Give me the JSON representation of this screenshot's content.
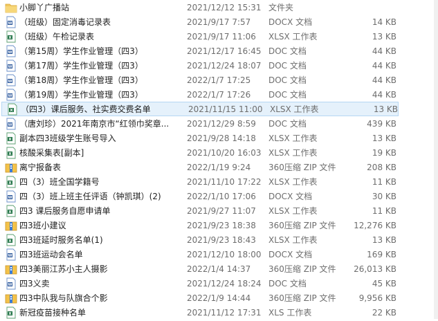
{
  "files": [
    {
      "name": "小脚丫广播站",
      "date": "2021/12/12 15:31",
      "type": "文件夹",
      "size": "",
      "icon": "folder-icon"
    },
    {
      "name": "（班级）固定消毒记录表",
      "date": "2021/9/17 7:57",
      "type": "DOCX 文档",
      "size": "14 KB",
      "icon": "word-doc-icon"
    },
    {
      "name": "（班级）午检记录表",
      "date": "2021/9/17 11:06",
      "type": "XLSX 工作表",
      "size": "13 KB",
      "icon": "excel-sheet-icon"
    },
    {
      "name": "（第15周）学生作业管理（四3）",
      "date": "2021/12/17 16:45",
      "type": "DOC 文档",
      "size": "44 KB",
      "icon": "word-doc-icon"
    },
    {
      "name": "（第17周）学生作业管理（四3）",
      "date": "2021/12/24 18:07",
      "type": "DOC 文档",
      "size": "44 KB",
      "icon": "word-doc-icon"
    },
    {
      "name": "（第18周）学生作业管理（四3）",
      "date": "2022/1/7 17:25",
      "type": "DOC 文档",
      "size": "44 KB",
      "icon": "word-doc-icon"
    },
    {
      "name": "（第19周）学生作业管理（四3）",
      "date": "2022/1/7 17:26",
      "type": "DOC 文档",
      "size": "44 KB",
      "icon": "word-doc-icon"
    },
    {
      "name": "（四3）课后服务、社实费交费名单",
      "date": "2021/11/15 11:00",
      "type": "XLSX 工作表",
      "size": "13 KB",
      "icon": "excel-sheet-icon",
      "selected": true
    },
    {
      "name": "（唐刘珍）2021年南京市“红领巾奖章...",
      "date": "2021/12/29 8:59",
      "type": "DOC 文档",
      "size": "439 KB",
      "icon": "word-doc-icon"
    },
    {
      "name": "副本四3班级学生账号导入",
      "date": "2021/9/28 14:18",
      "type": "XLSX 工作表",
      "size": "13 KB",
      "icon": "excel-sheet-icon"
    },
    {
      "name": "核酸采集表[副本]",
      "date": "2021/10/20 16:03",
      "type": "XLSX 工作表",
      "size": "19 KB",
      "icon": "excel-sheet-icon"
    },
    {
      "name": "离宁报备表",
      "date": "2022/1/19 9:24",
      "type": "360压缩 ZIP 文件",
      "size": "208 KB",
      "icon": "zip-archive-icon"
    },
    {
      "name": "四（3）班全国学籍号",
      "date": "2021/11/10 17:22",
      "type": "XLSX 工作表",
      "size": "11 KB",
      "icon": "excel-sheet-icon"
    },
    {
      "name": "四（3）班上班主任评语（钟凯琪）(2)",
      "date": "2022/1/10 17:06",
      "type": "DOCX 文档",
      "size": "30 KB",
      "icon": "word-doc-icon"
    },
    {
      "name": "四3 课后服务自愿申请单",
      "date": "2021/9/27 11:07",
      "type": "XLSX 工作表",
      "size": "11 KB",
      "icon": "excel-sheet-icon"
    },
    {
      "name": "四3班小建议",
      "date": "2021/9/23 18:38",
      "type": "360压缩 ZIP 文件",
      "size": "12,276 KB",
      "icon": "zip-archive-icon"
    },
    {
      "name": "四3班延时服务名单(1)",
      "date": "2021/9/23 18:43",
      "type": "XLSX 工作表",
      "size": "13 KB",
      "icon": "excel-sheet-icon"
    },
    {
      "name": "四3班运动会名单",
      "date": "2021/12/10 18:00",
      "type": "DOCX 文档",
      "size": "169 KB",
      "icon": "word-doc-icon"
    },
    {
      "name": "四3美丽江苏小主人摄影",
      "date": "2022/1/4 14:37",
      "type": "360压缩 ZIP 文件",
      "size": "26,013 KB",
      "icon": "zip-archive-icon"
    },
    {
      "name": "四3义卖",
      "date": "2021/12/24 18:24",
      "type": "DOC 文档",
      "size": "45 KB",
      "icon": "word-doc-icon"
    },
    {
      "name": "四3中队我与队旗合个影",
      "date": "2022/1/9 14:44",
      "type": "360压缩 ZIP 文件",
      "size": "9,956 KB",
      "icon": "zip-archive-icon"
    },
    {
      "name": "新冠疫苗接种名单",
      "date": "2021/11/12 17:31",
      "type": "XLS 工作表",
      "size": "22 KB",
      "icon": "excel-sheet-icon"
    }
  ]
}
